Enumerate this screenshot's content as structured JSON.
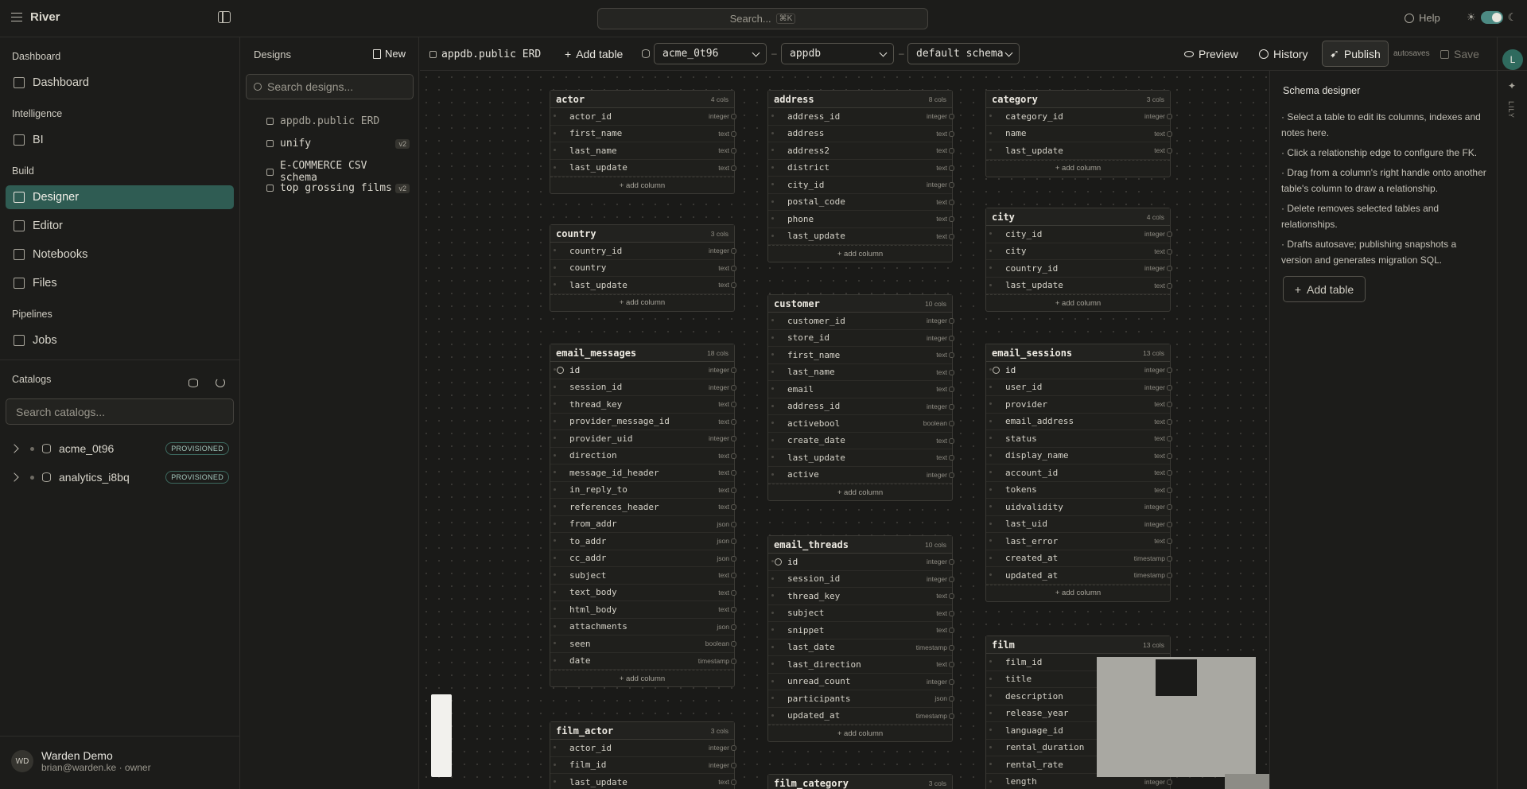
{
  "app": {
    "name": "River",
    "search_placeholder": "Search...",
    "search_kbd": "⌘K",
    "help": "Help"
  },
  "nav": {
    "sections": [
      "Dashboard",
      "Intelligence",
      "Build",
      "Pipelines",
      "Catalogs"
    ],
    "items": [
      {
        "label": "Dashboard"
      },
      {
        "label": "BI"
      },
      {
        "label": "Designer"
      },
      {
        "label": "Editor"
      },
      {
        "label": "Notebooks"
      },
      {
        "label": "Files"
      },
      {
        "label": "Jobs"
      }
    ],
    "catalog_search_placeholder": "Search catalogs...",
    "catalogs": [
      {
        "name": "acme_0t96",
        "status": "PROVISIONED"
      },
      {
        "name": "analytics_i8bq",
        "status": "PROVISIONED"
      }
    ],
    "user": {
      "initials": "WD",
      "name": "Warden Demo",
      "email": "brian@warden.ke · owner"
    }
  },
  "designs": {
    "title": "Designs",
    "new_label": "New",
    "search_placeholder": "Search designs...",
    "items": [
      {
        "name": "appdb.public ERD",
        "version": ""
      },
      {
        "name": "unify",
        "version": "v2"
      },
      {
        "name": "E-COMMERCE CSV schema",
        "version": ""
      },
      {
        "name": "top grossing films",
        "version": "v2"
      }
    ]
  },
  "toolbar": {
    "design_name": "appdb.public ERD",
    "add_table": "Add table",
    "catalog": "acme_0t96",
    "database": "appdb",
    "schema": "default schema",
    "preview": "Preview",
    "history": "History",
    "publish": "Publish",
    "autosaves": "autosaves",
    "save": "Save"
  },
  "tables": [
    {
      "name": "actor",
      "count": "4 cols",
      "cols": [
        [
          "actor_id",
          "integer"
        ],
        [
          "first_name",
          "text"
        ],
        [
          "last_name",
          "text"
        ],
        [
          "last_update",
          "text"
        ]
      ],
      "pk": false
    },
    {
      "name": "address",
      "count": "8 cols",
      "cols": [
        [
          "address_id",
          "integer"
        ],
        [
          "address",
          "text"
        ],
        [
          "address2",
          "text"
        ],
        [
          "district",
          "text"
        ],
        [
          "city_id",
          "integer"
        ],
        [
          "postal_code",
          "text"
        ],
        [
          "phone",
          "text"
        ],
        [
          "last_update",
          "text"
        ]
      ],
      "pk": false
    },
    {
      "name": "category",
      "count": "3 cols",
      "cols": [
        [
          "category_id",
          "integer"
        ],
        [
          "name",
          "text"
        ],
        [
          "last_update",
          "text"
        ]
      ],
      "pk": false
    },
    {
      "name": "country",
      "count": "3 cols",
      "cols": [
        [
          "country_id",
          "integer"
        ],
        [
          "country",
          "text"
        ],
        [
          "last_update",
          "text"
        ]
      ],
      "pk": false
    },
    {
      "name": "city",
      "count": "4 cols",
      "cols": [
        [
          "city_id",
          "integer"
        ],
        [
          "city",
          "text"
        ],
        [
          "country_id",
          "integer"
        ],
        [
          "last_update",
          "text"
        ]
      ],
      "pk": false
    },
    {
      "name": "customer",
      "count": "10 cols",
      "cols": [
        [
          "customer_id",
          "integer"
        ],
        [
          "store_id",
          "integer"
        ],
        [
          "first_name",
          "text"
        ],
        [
          "last_name",
          "text"
        ],
        [
          "email",
          "text"
        ],
        [
          "address_id",
          "integer"
        ],
        [
          "activebool",
          "boolean"
        ],
        [
          "create_date",
          "text"
        ],
        [
          "last_update",
          "text"
        ],
        [
          "active",
          "integer"
        ]
      ],
      "pk": false
    },
    {
      "name": "email_messages",
      "count": "18 cols",
      "cols": [
        [
          "id",
          "integer"
        ],
        [
          "session_id",
          "integer"
        ],
        [
          "thread_key",
          "text"
        ],
        [
          "provider_message_id",
          "text"
        ],
        [
          "provider_uid",
          "integer"
        ],
        [
          "direction",
          "text"
        ],
        [
          "message_id_header",
          "text"
        ],
        [
          "in_reply_to",
          "text"
        ],
        [
          "references_header",
          "text"
        ],
        [
          "from_addr",
          "json"
        ],
        [
          "to_addr",
          "json"
        ],
        [
          "cc_addr",
          "json"
        ],
        [
          "subject",
          "text"
        ],
        [
          "text_body",
          "text"
        ],
        [
          "html_body",
          "text"
        ],
        [
          "attachments",
          "json"
        ],
        [
          "seen",
          "boolean"
        ],
        [
          "date",
          "timestamp"
        ]
      ],
      "pk": true
    },
    {
      "name": "email_sessions",
      "count": "13 cols",
      "cols": [
        [
          "id",
          "integer"
        ],
        [
          "user_id",
          "integer"
        ],
        [
          "provider",
          "text"
        ],
        [
          "email_address",
          "text"
        ],
        [
          "status",
          "text"
        ],
        [
          "display_name",
          "text"
        ],
        [
          "account_id",
          "text"
        ],
        [
          "tokens",
          "text"
        ],
        [
          "uidvalidity",
          "integer"
        ],
        [
          "last_uid",
          "integer"
        ],
        [
          "last_error",
          "text"
        ],
        [
          "created_at",
          "timestamp"
        ],
        [
          "updated_at",
          "timestamp"
        ]
      ],
      "pk": true
    },
    {
      "name": "email_threads",
      "count": "10 cols",
      "cols": [
        [
          "id",
          "integer"
        ],
        [
          "session_id",
          "integer"
        ],
        [
          "thread_key",
          "text"
        ],
        [
          "subject",
          "text"
        ],
        [
          "snippet",
          "text"
        ],
        [
          "last_date",
          "timestamp"
        ],
        [
          "last_direction",
          "text"
        ],
        [
          "unread_count",
          "integer"
        ],
        [
          "participants",
          "json"
        ],
        [
          "updated_at",
          "timestamp"
        ]
      ],
      "pk": true
    },
    {
      "name": "film",
      "count": "13 cols",
      "cols": [
        [
          "film_id",
          "integer"
        ],
        [
          "title",
          "text"
        ],
        [
          "description",
          "text"
        ],
        [
          "release_year",
          "integer"
        ],
        [
          "language_id",
          "integer"
        ],
        [
          "rental_duration",
          "integer"
        ],
        [
          "rental_rate",
          "text"
        ],
        [
          "length",
          "integer"
        ]
      ],
      "pk": false
    },
    {
      "name": "film_actor",
      "count": "3 cols",
      "cols": [
        [
          "actor_id",
          "integer"
        ],
        [
          "film_id",
          "integer"
        ],
        [
          "last_update",
          "text"
        ]
      ],
      "pk": false
    },
    {
      "name": "film_category",
      "count": "3 cols",
      "cols": [],
      "pk": false
    }
  ],
  "add_column_label": "add column",
  "right_panel": {
    "title": "Schema designer",
    "lines": [
      "· Select a table to edit its columns, indexes and notes here.",
      "· Click a relationship edge to configure the FK.",
      "· Drag from a column's right handle onto another table's column to draw a relationship.",
      "· Delete removes selected tables and relationships.",
      "· Drafts autosave; publishing snapshots a version and generates migration SQL."
    ],
    "add_table": "Add table"
  },
  "rail": {
    "avatar": "L",
    "label": "LILY"
  },
  "icons": [
    "menu-icon",
    "sidebar-toggle-icon",
    "help-icon",
    "sun-icon",
    "moon-icon",
    "dashboard-icon",
    "bi-icon",
    "designer-icon",
    "editor-icon",
    "notebooks-icon",
    "files-icon",
    "jobs-icon",
    "db-icon",
    "refresh-icon",
    "new-file-icon",
    "search-icon",
    "tree-icon",
    "plus-icon",
    "eye-icon",
    "history-icon",
    "publish-icon",
    "save-icon",
    "key-icon",
    "sparkle-icon"
  ],
  "colors": {
    "accent": "#2f5c53",
    "background": "#1c1c1a",
    "switch": "#4c8a83"
  }
}
